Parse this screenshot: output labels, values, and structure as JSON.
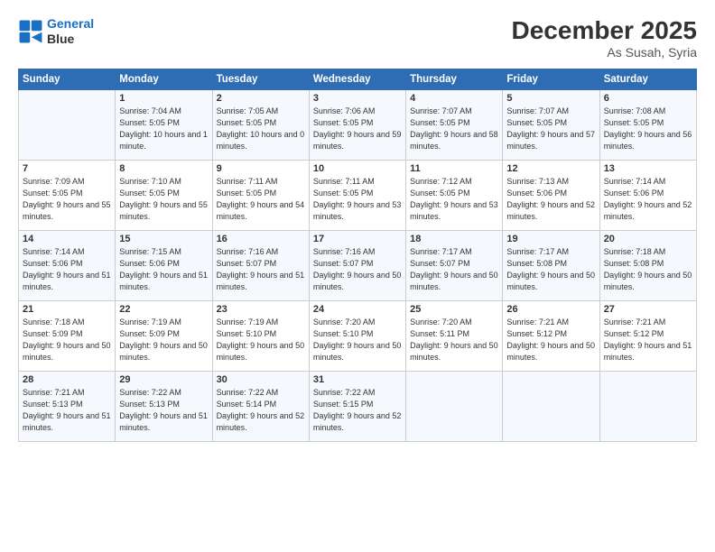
{
  "logo": {
    "line1": "General",
    "line2": "Blue"
  },
  "title": "December 2025",
  "subtitle": "As Susah, Syria",
  "header_days": [
    "Sunday",
    "Monday",
    "Tuesday",
    "Wednesday",
    "Thursday",
    "Friday",
    "Saturday"
  ],
  "weeks": [
    [
      {
        "day": "",
        "sunrise": "",
        "sunset": "",
        "daylight": ""
      },
      {
        "day": "1",
        "sunrise": "Sunrise: 7:04 AM",
        "sunset": "Sunset: 5:05 PM",
        "daylight": "Daylight: 10 hours and 1 minute."
      },
      {
        "day": "2",
        "sunrise": "Sunrise: 7:05 AM",
        "sunset": "Sunset: 5:05 PM",
        "daylight": "Daylight: 10 hours and 0 minutes."
      },
      {
        "day": "3",
        "sunrise": "Sunrise: 7:06 AM",
        "sunset": "Sunset: 5:05 PM",
        "daylight": "Daylight: 9 hours and 59 minutes."
      },
      {
        "day": "4",
        "sunrise": "Sunrise: 7:07 AM",
        "sunset": "Sunset: 5:05 PM",
        "daylight": "Daylight: 9 hours and 58 minutes."
      },
      {
        "day": "5",
        "sunrise": "Sunrise: 7:07 AM",
        "sunset": "Sunset: 5:05 PM",
        "daylight": "Daylight: 9 hours and 57 minutes."
      },
      {
        "day": "6",
        "sunrise": "Sunrise: 7:08 AM",
        "sunset": "Sunset: 5:05 PM",
        "daylight": "Daylight: 9 hours and 56 minutes."
      }
    ],
    [
      {
        "day": "7",
        "sunrise": "Sunrise: 7:09 AM",
        "sunset": "Sunset: 5:05 PM",
        "daylight": "Daylight: 9 hours and 55 minutes."
      },
      {
        "day": "8",
        "sunrise": "Sunrise: 7:10 AM",
        "sunset": "Sunset: 5:05 PM",
        "daylight": "Daylight: 9 hours and 55 minutes."
      },
      {
        "day": "9",
        "sunrise": "Sunrise: 7:11 AM",
        "sunset": "Sunset: 5:05 PM",
        "daylight": "Daylight: 9 hours and 54 minutes."
      },
      {
        "day": "10",
        "sunrise": "Sunrise: 7:11 AM",
        "sunset": "Sunset: 5:05 PM",
        "daylight": "Daylight: 9 hours and 53 minutes."
      },
      {
        "day": "11",
        "sunrise": "Sunrise: 7:12 AM",
        "sunset": "Sunset: 5:05 PM",
        "daylight": "Daylight: 9 hours and 53 minutes."
      },
      {
        "day": "12",
        "sunrise": "Sunrise: 7:13 AM",
        "sunset": "Sunset: 5:06 PM",
        "daylight": "Daylight: 9 hours and 52 minutes."
      },
      {
        "day": "13",
        "sunrise": "Sunrise: 7:14 AM",
        "sunset": "Sunset: 5:06 PM",
        "daylight": "Daylight: 9 hours and 52 minutes."
      }
    ],
    [
      {
        "day": "14",
        "sunrise": "Sunrise: 7:14 AM",
        "sunset": "Sunset: 5:06 PM",
        "daylight": "Daylight: 9 hours and 51 minutes."
      },
      {
        "day": "15",
        "sunrise": "Sunrise: 7:15 AM",
        "sunset": "Sunset: 5:06 PM",
        "daylight": "Daylight: 9 hours and 51 minutes."
      },
      {
        "day": "16",
        "sunrise": "Sunrise: 7:16 AM",
        "sunset": "Sunset: 5:07 PM",
        "daylight": "Daylight: 9 hours and 51 minutes."
      },
      {
        "day": "17",
        "sunrise": "Sunrise: 7:16 AM",
        "sunset": "Sunset: 5:07 PM",
        "daylight": "Daylight: 9 hours and 50 minutes."
      },
      {
        "day": "18",
        "sunrise": "Sunrise: 7:17 AM",
        "sunset": "Sunset: 5:07 PM",
        "daylight": "Daylight: 9 hours and 50 minutes."
      },
      {
        "day": "19",
        "sunrise": "Sunrise: 7:17 AM",
        "sunset": "Sunset: 5:08 PM",
        "daylight": "Daylight: 9 hours and 50 minutes."
      },
      {
        "day": "20",
        "sunrise": "Sunrise: 7:18 AM",
        "sunset": "Sunset: 5:08 PM",
        "daylight": "Daylight: 9 hours and 50 minutes."
      }
    ],
    [
      {
        "day": "21",
        "sunrise": "Sunrise: 7:18 AM",
        "sunset": "Sunset: 5:09 PM",
        "daylight": "Daylight: 9 hours and 50 minutes."
      },
      {
        "day": "22",
        "sunrise": "Sunrise: 7:19 AM",
        "sunset": "Sunset: 5:09 PM",
        "daylight": "Daylight: 9 hours and 50 minutes."
      },
      {
        "day": "23",
        "sunrise": "Sunrise: 7:19 AM",
        "sunset": "Sunset: 5:10 PM",
        "daylight": "Daylight: 9 hours and 50 minutes."
      },
      {
        "day": "24",
        "sunrise": "Sunrise: 7:20 AM",
        "sunset": "Sunset: 5:10 PM",
        "daylight": "Daylight: 9 hours and 50 minutes."
      },
      {
        "day": "25",
        "sunrise": "Sunrise: 7:20 AM",
        "sunset": "Sunset: 5:11 PM",
        "daylight": "Daylight: 9 hours and 50 minutes."
      },
      {
        "day": "26",
        "sunrise": "Sunrise: 7:21 AM",
        "sunset": "Sunset: 5:12 PM",
        "daylight": "Daylight: 9 hours and 50 minutes."
      },
      {
        "day": "27",
        "sunrise": "Sunrise: 7:21 AM",
        "sunset": "Sunset: 5:12 PM",
        "daylight": "Daylight: 9 hours and 51 minutes."
      }
    ],
    [
      {
        "day": "28",
        "sunrise": "Sunrise: 7:21 AM",
        "sunset": "Sunset: 5:13 PM",
        "daylight": "Daylight: 9 hours and 51 minutes."
      },
      {
        "day": "29",
        "sunrise": "Sunrise: 7:22 AM",
        "sunset": "Sunset: 5:13 PM",
        "daylight": "Daylight: 9 hours and 51 minutes."
      },
      {
        "day": "30",
        "sunrise": "Sunrise: 7:22 AM",
        "sunset": "Sunset: 5:14 PM",
        "daylight": "Daylight: 9 hours and 52 minutes."
      },
      {
        "day": "31",
        "sunrise": "Sunrise: 7:22 AM",
        "sunset": "Sunset: 5:15 PM",
        "daylight": "Daylight: 9 hours and 52 minutes."
      },
      {
        "day": "",
        "sunrise": "",
        "sunset": "",
        "daylight": ""
      },
      {
        "day": "",
        "sunrise": "",
        "sunset": "",
        "daylight": ""
      },
      {
        "day": "",
        "sunrise": "",
        "sunset": "",
        "daylight": ""
      }
    ]
  ]
}
